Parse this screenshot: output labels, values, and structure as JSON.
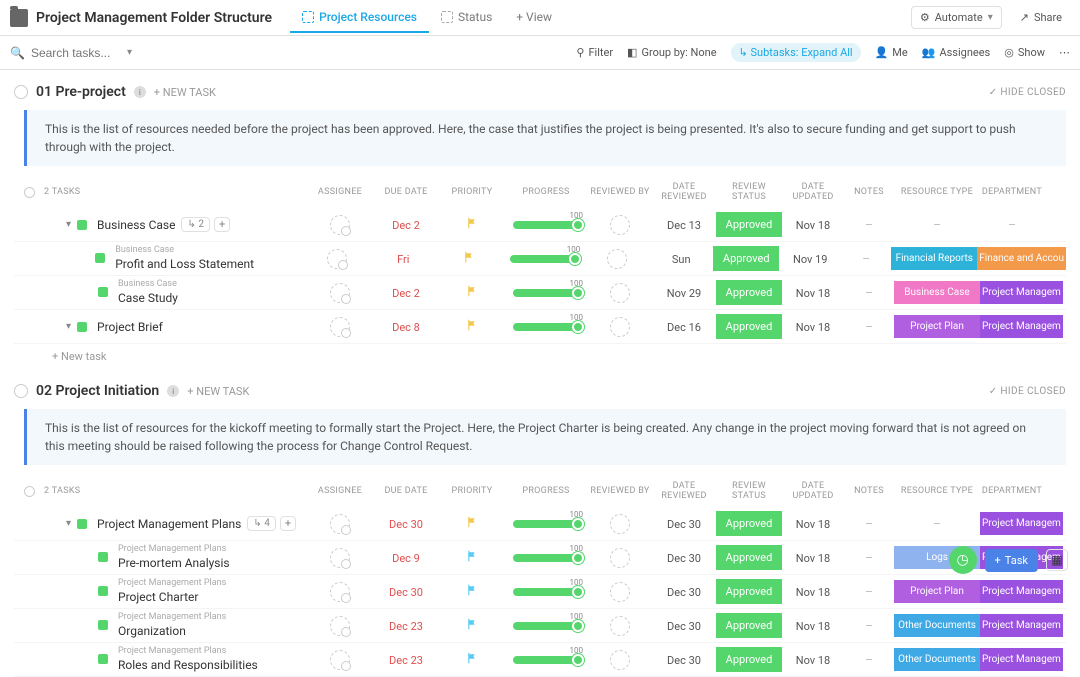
{
  "header": {
    "title": "Project Management Folder Structure",
    "tabs": [
      {
        "label": "Project Resources",
        "active": true
      },
      {
        "label": "Status",
        "active": false
      }
    ],
    "add_view": "+ View",
    "automate": "Automate",
    "share": "Share"
  },
  "subheader": {
    "search_ph": "Search tasks...",
    "filter": "Filter",
    "group": "Group by: None",
    "subtasks": "Subtasks: Expand All",
    "me": "Me",
    "assignees": "Assignees",
    "show": "Show"
  },
  "columns": {
    "tasks": "2 TASKS",
    "assignee": "ASSIGNEE",
    "due": "DUE DATE",
    "priority": "PRIORITY",
    "progress": "PROGRESS",
    "revby": "REVIEWED BY",
    "drev": "DATE REVIEWED",
    "rstat": "REVIEW STATUS",
    "dupd": "DATE UPDATED",
    "notes": "NOTES",
    "rtype": "RESOURCE TYPE",
    "dept": "DEPARTMENT"
  },
  "sections": [
    {
      "title": "01 Pre-project",
      "new_task": "+ NEW TASK",
      "hide": "HIDE CLOSED",
      "desc": "This is the list of resources needed before the project has been approved. Here, the case that justifies the project is being presented. It's also to secure funding and get support to push through with the project.",
      "rows": [
        {
          "type": "top",
          "name": "Business Case",
          "tag": "2",
          "due": "Dec 2",
          "flag": "yellow",
          "progress": 100,
          "drev": "Dec 13",
          "rstat": "Approved",
          "dupd": "Nov 18",
          "notes": "–",
          "rtype": "",
          "rtype_color": "",
          "dept": "–",
          "dept_color": ""
        },
        {
          "type": "sub",
          "parent": "Business Case",
          "name": "Profit and Loss Statement",
          "due": "Fri",
          "flag": "yellow",
          "progress": 100,
          "drev": "Sun",
          "rstat": "Approved",
          "dupd": "Nov 19",
          "notes": "–",
          "rtype": "Financial Reports",
          "rtype_color": "#2db2d9",
          "dept": "Finance and Accou",
          "dept_color": "#f2994a"
        },
        {
          "type": "sub",
          "parent": "Business Case",
          "name": "Case Study",
          "due": "Dec 2",
          "flag": "yellow",
          "progress": 100,
          "drev": "Nov 29",
          "rstat": "Approved",
          "dupd": "Nov 18",
          "notes": "–",
          "rtype": "Business Case",
          "rtype_color": "#f178c6",
          "dept": "Project Managem",
          "dept_color": "#9b51e0"
        },
        {
          "type": "top",
          "name": "Project Brief",
          "tag": "",
          "due": "Dec 8",
          "flag": "yellow",
          "progress": 100,
          "drev": "Dec 16",
          "rstat": "Approved",
          "dupd": "Nov 18",
          "notes": "–",
          "rtype": "Project Plan",
          "rtype_color": "#b05fe0",
          "dept": "Project Managem",
          "dept_color": "#9b51e0"
        }
      ],
      "add_row": "+ New task"
    },
    {
      "title": "02 Project Initiation",
      "new_task": "+ NEW TASK",
      "hide": "HIDE CLOSED",
      "desc": "This is the list of resources for the kickoff meeting to formally start the Project. Here, the Project Charter is being created. Any change in the project moving forward that is not agreed on this meeting should be raised following the process for Change Control Request.",
      "rows": [
        {
          "type": "top",
          "name": "Project Management Plans",
          "tag": "4",
          "due": "Dec 30",
          "flag": "yellow",
          "progress": 100,
          "drev": "Dec 30",
          "rstat": "Approved",
          "dupd": "Nov 18",
          "notes": "–",
          "rtype": "",
          "rtype_color": "",
          "dept": "Project Managem",
          "dept_color": "#9b51e0"
        },
        {
          "type": "sub",
          "parent": "Project Management Plans",
          "name": "Pre-mortem Analysis",
          "due": "Dec 9",
          "flag": "blue",
          "progress": 100,
          "drev": "Dec 30",
          "rstat": "Approved",
          "dupd": "Nov 18",
          "notes": "–",
          "rtype": "Logs",
          "rtype_color": "#8fb3ef",
          "dept": "Project Managem",
          "dept_color": "#9b51e0"
        },
        {
          "type": "sub",
          "parent": "Project Management Plans",
          "name": "Project Charter",
          "due": "Dec 30",
          "flag": "blue",
          "progress": 100,
          "drev": "Dec 30",
          "rstat": "Approved",
          "dupd": "Nov 18",
          "notes": "–",
          "rtype": "Project Plan",
          "rtype_color": "#b05fe0",
          "dept": "Project Managem",
          "dept_color": "#9b51e0"
        },
        {
          "type": "sub",
          "parent": "Project Management Plans",
          "name": "Organization",
          "due": "Dec 23",
          "flag": "blue",
          "progress": 100,
          "drev": "Dec 30",
          "rstat": "Approved",
          "dupd": "Nov 18",
          "notes": "–",
          "rtype": "Other Documents",
          "rtype_color": "#3fa9e6",
          "dept": "Project Managem",
          "dept_color": "#9b51e0"
        },
        {
          "type": "sub",
          "parent": "Project Management Plans",
          "name": "Roles and Responsibilities",
          "due": "Dec 23",
          "flag": "blue",
          "progress": 100,
          "drev": "Dec 30",
          "rstat": "Approved",
          "dupd": "Nov 18",
          "notes": "–",
          "rtype": "Other Documents",
          "rtype_color": "#3fa9e6",
          "dept": "Project Managem",
          "dept_color": "#9b51e0"
        }
      ]
    }
  ],
  "bottom": {
    "task": "Task"
  }
}
